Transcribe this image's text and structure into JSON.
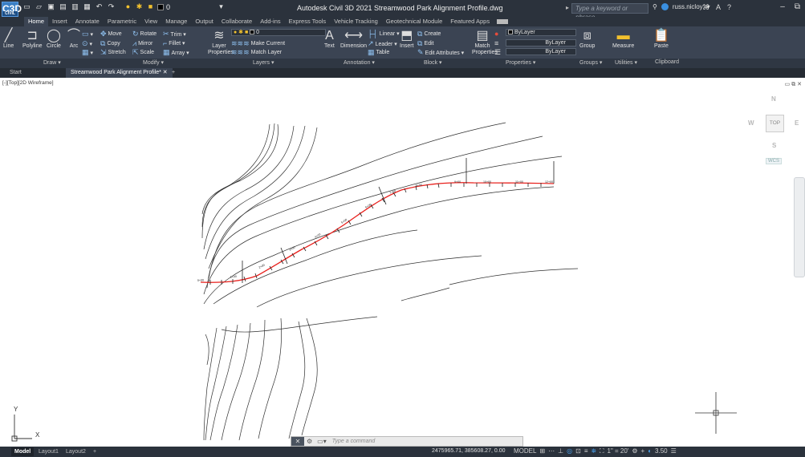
{
  "title_bar": {
    "app_logo": "C3D",
    "app_logo_sub": "CIVIL",
    "layer_value": "0",
    "window_title": "Autodesk Civil 3D 2021   Streamwood Park Alignment Profile.dwg",
    "search_placeholder": "Type a keyword or phrase",
    "username": "russ.nicloy"
  },
  "ribbon_tabs": [
    "Home",
    "Insert",
    "Annotate",
    "Parametric",
    "View",
    "Manage",
    "Output",
    "Collaborate",
    "Add-ins",
    "Express Tools",
    "Vehicle Tracking",
    "Geotechnical Module",
    "Featured Apps"
  ],
  "ribbon": {
    "draw": {
      "title": "Draw ▾",
      "line": "Line",
      "polyline": "Polyline",
      "circle": "Circle",
      "arc": "Arc"
    },
    "modify": {
      "title": "Modify ▾",
      "move": "Move",
      "rotate": "Rotate",
      "trim": "Trim ▾",
      "copy": "Copy",
      "mirror": "Mirror",
      "fillet": "Fillet ▾",
      "stretch": "Stretch",
      "scale": "Scale",
      "array": "Array ▾"
    },
    "layers": {
      "title": "Layers ▾",
      "layer_properties": "Layer Properties",
      "current_layer": "0",
      "make_current": "Make Current",
      "match_layer": "Match Layer"
    },
    "annotation": {
      "title": "Annotation ▾",
      "text": "Text",
      "dimension": "Dimension",
      "linear": "Linear ▾",
      "leader": "Leader ▾",
      "table": "Table"
    },
    "block": {
      "title": "Block ▾",
      "insert": "Insert",
      "create": "Create",
      "edit": "Edit",
      "edit_attributes": "Edit Attributes ▾"
    },
    "properties": {
      "title": "Properties ▾",
      "match": "Match Properties",
      "color": "ByLayer",
      "linetype": "ByLayer",
      "lineweight": "ByLayer"
    },
    "groups": {
      "title": "Groups ▾",
      "group": "Group"
    },
    "utilities": {
      "title": "Utilities ▾",
      "measure": "Measure"
    },
    "clipboard": {
      "title": "Clipboard",
      "paste": "Paste"
    }
  },
  "doc_tabs": {
    "start": "Start",
    "active": "Streamwood Park Alignment Profile*"
  },
  "viewport": {
    "label": "[-][Top][2D Wireframe]",
    "viewcube": {
      "north": "N",
      "south": "S",
      "east": "E",
      "west": "W",
      "top": "TOP",
      "wcs": "WCS"
    },
    "ucs_y": "Y",
    "ucs_x": "X"
  },
  "command_line": {
    "placeholder": "Type a command"
  },
  "status_bar": {
    "layouts": [
      "Model",
      "Layout1",
      "Layout2"
    ],
    "coords": "2475965.71, 385608.27, 0.00",
    "model": "MODEL",
    "scale": "1\" = 20'",
    "zoom": "3.50"
  },
  "colors": {
    "alignment": "#e8201c",
    "ribbon_bg": "#3b4453",
    "title_bg": "#2b323c",
    "contours": "#333333"
  },
  "station_labels": [
    "0+00",
    "1+00",
    "2+00",
    "3+00",
    "4+00",
    "5+00",
    "6+00",
    "7+00",
    "8+00",
    "9+00",
    "10+00",
    "11+00",
    "12+00",
    "13+00"
  ]
}
